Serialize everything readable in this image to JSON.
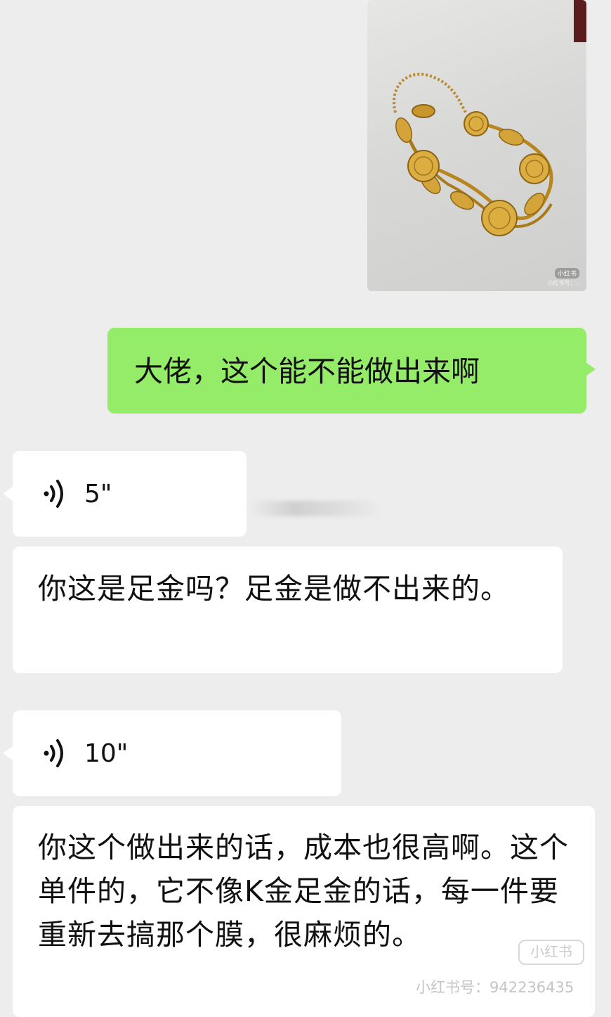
{
  "messages": {
    "image": {
      "badge": "小红书",
      "watermark": "小红书号：..."
    },
    "sent_text": "大佬，这个能不能做出来啊",
    "voice1": {
      "duration": "5\""
    },
    "reply1": "你这是足金吗？足金是做不出来的。",
    "voice2": {
      "duration": "10\""
    },
    "reply2": "你这个做出来的话，成本也很高啊。这个单件的，它不像K金足金的话，每一件要重新去搞那个膜，很麻烦的。"
  },
  "watermark": {
    "logo": "小红书",
    "id": "小红书号：942236435"
  }
}
